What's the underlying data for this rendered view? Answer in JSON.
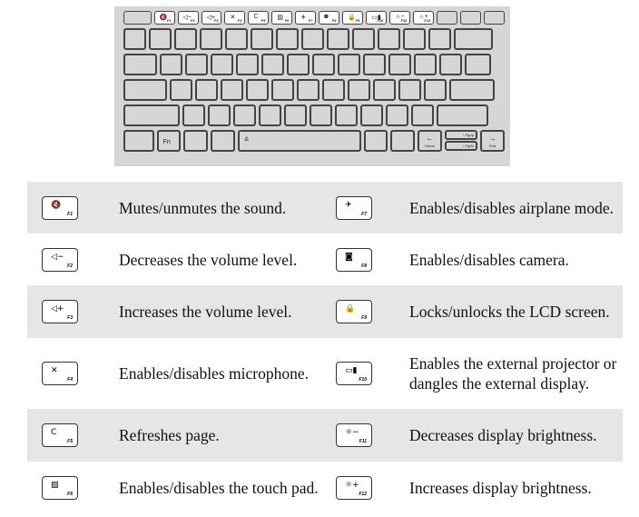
{
  "keyboard": {
    "fn_keys": [
      {
        "glyph": "",
        "label": ""
      },
      {
        "glyph": "🔇",
        "label": "F1"
      },
      {
        "glyph": "◁−",
        "label": "F2"
      },
      {
        "glyph": "◁+",
        "label": "F3"
      },
      {
        "glyph": "✕",
        "label": "F4"
      },
      {
        "glyph": "C",
        "label": "F5"
      },
      {
        "glyph": "▨",
        "label": "F6"
      },
      {
        "glyph": "✈",
        "label": "F7"
      },
      {
        "glyph": "◙",
        "label": "F8"
      },
      {
        "glyph": "🔒",
        "label": "F9"
      },
      {
        "glyph": "▭▮",
        "label": "F10"
      },
      {
        "glyph": "☼−",
        "label": "F11"
      },
      {
        "glyph": "☼+",
        "label": "F12"
      },
      {
        "glyph": "",
        "label": ""
      },
      {
        "glyph": "",
        "label": ""
      },
      {
        "glyph": "",
        "label": ""
      }
    ],
    "fn_label": "Fn",
    "pgup_label": "PgUp",
    "pgdn_label": "PgDn",
    "home_label": "Home",
    "end_label": "End"
  },
  "rows": [
    {
      "left": {
        "glyph": "🔇",
        "key": "F1",
        "text": "Mutes/unmutes the sound."
      },
      "right": {
        "glyph": "✈",
        "key": "F7",
        "text": "Enables/disables airplane mode."
      },
      "shade": true
    },
    {
      "left": {
        "glyph": "◁−",
        "key": "F2",
        "text": "Decreases the volume level."
      },
      "right": {
        "glyph": "◙",
        "key": "F8",
        "text": "Enables/disables camera."
      },
      "shade": false
    },
    {
      "left": {
        "glyph": "◁+",
        "key": "F3",
        "text": "Increases the volume level."
      },
      "right": {
        "glyph": "🔒",
        "key": "F9",
        "text": "Locks/unlocks the LCD screen."
      },
      "shade": true
    },
    {
      "left": {
        "glyph": "✕",
        "key": "F4",
        "text": "Enables/disables microphone."
      },
      "right": {
        "glyph": "▭▮",
        "key": "F10",
        "text": "Enables the external projector or dangles the external display."
      },
      "shade": false
    },
    {
      "left": {
        "glyph": "C",
        "key": "F5",
        "text": "Refreshes page."
      },
      "right": {
        "glyph": "☼−",
        "key": "F11",
        "text": "Decreases display brightness."
      },
      "shade": true
    },
    {
      "left": {
        "glyph": "▨",
        "key": "F6",
        "text": "Enables/disables the touch pad."
      },
      "right": {
        "glyph": "☼+",
        "key": "F12",
        "text": "Increases display brightness."
      },
      "shade": false
    }
  ]
}
